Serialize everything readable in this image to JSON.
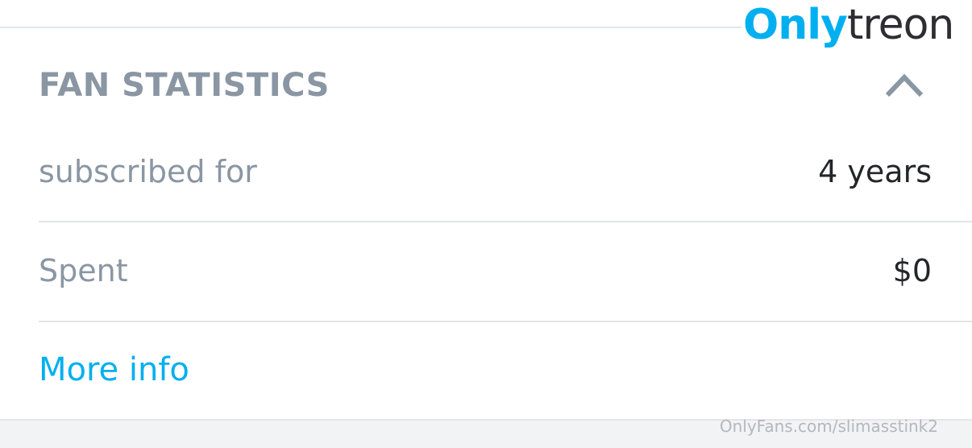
{
  "brand": {
    "logo_part_1": "Only",
    "logo_part_2": "treon"
  },
  "panel": {
    "title": "FAN STATISTICS",
    "toggle_icon": "chevron-up-icon"
  },
  "stats": [
    {
      "label": "subscribed for",
      "value": "4 years"
    },
    {
      "label": "Spent",
      "value": "$0"
    }
  ],
  "more_info_label": "More info",
  "watermark": "OnlyFans.com/slimasstink2",
  "colors": {
    "accent": "#00aff0",
    "muted_text": "#8a96a3",
    "value_text": "#242529",
    "divider": "#e3e5e8"
  }
}
